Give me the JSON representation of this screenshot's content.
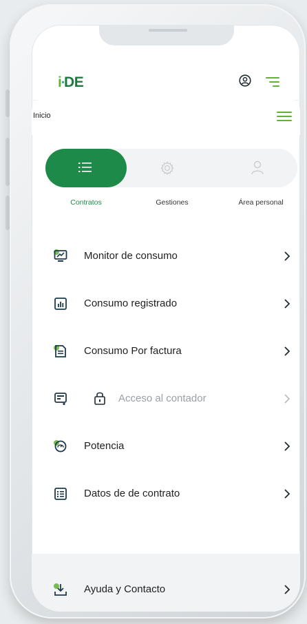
{
  "app": {
    "logo_i": "i",
    "logo_dot": "•",
    "logo_de": "DE"
  },
  "breadcrumb": {
    "label": "Inicio"
  },
  "tabs": [
    {
      "label": "Contratos",
      "icon": "list-icon",
      "active": true
    },
    {
      "label": "Gestiones",
      "icon": "gear-icon",
      "active": false
    },
    {
      "label": "Área personal",
      "icon": "user-icon",
      "active": false
    }
  ],
  "menu": [
    {
      "label": "Monitor de consumo",
      "icon": "monitor-icon",
      "disabled": false
    },
    {
      "label": "Consumo registrado",
      "icon": "bar-chart-icon",
      "disabled": false
    },
    {
      "label": "Consumo Por factura",
      "icon": "invoice-icon",
      "disabled": false
    },
    {
      "label": "Acceso al contador",
      "icon": "meter-icon",
      "disabled": true
    },
    {
      "label": "Potencia",
      "icon": "gauge-icon",
      "disabled": false
    },
    {
      "label": "Datos de de contrato",
      "icon": "contract-list-icon",
      "disabled": false
    }
  ],
  "footer": {
    "label": "Ayuda y Contacto",
    "icon": "download-help-icon"
  },
  "colors": {
    "brand_green": "#1d8a4a",
    "light_green": "#5fb233",
    "icon_dark": "#1e3a4a"
  }
}
